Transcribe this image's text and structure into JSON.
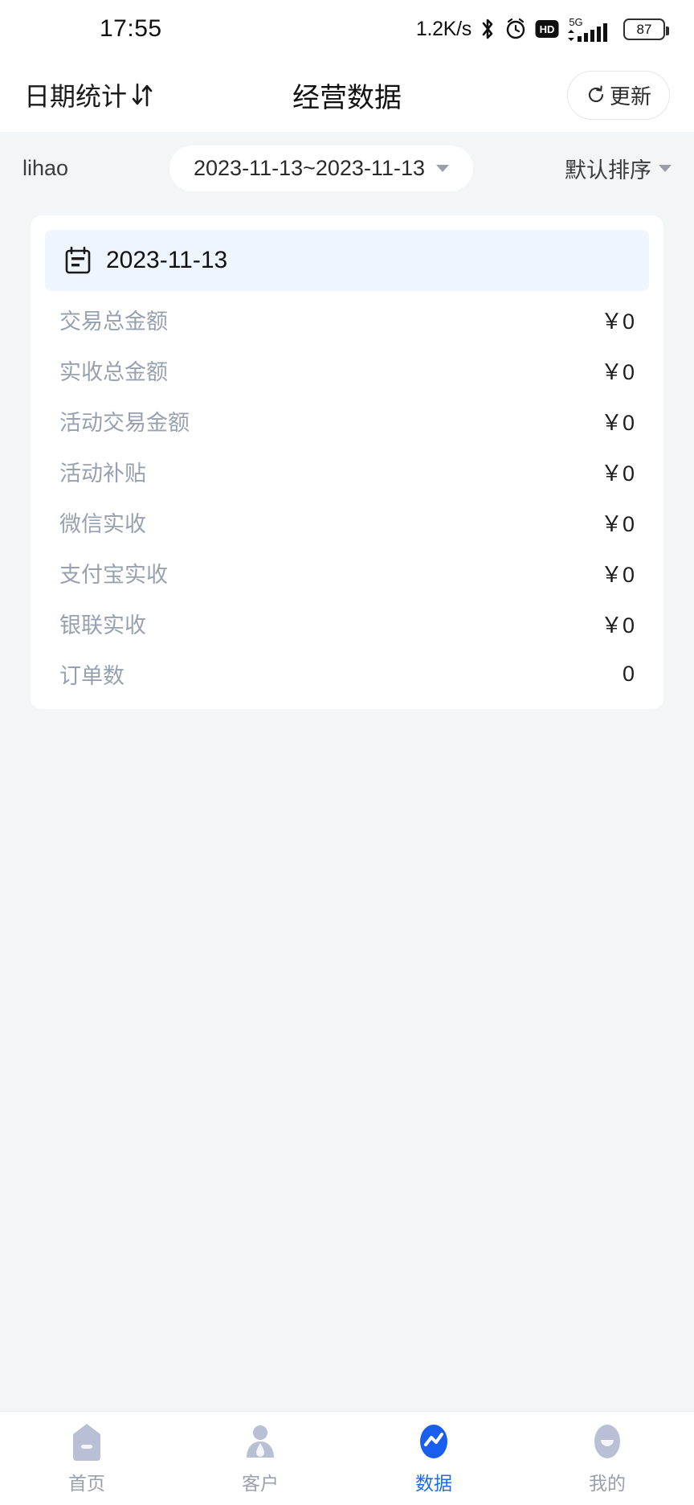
{
  "status_bar": {
    "time": "17:55",
    "network_speed": "1.2K/s",
    "battery_percent": "87",
    "icons": [
      "bluetooth-icon",
      "alarm-icon",
      "hd-icon",
      "signal-5g-icon",
      "battery-icon"
    ]
  },
  "header": {
    "left_label": "日期统计",
    "left_icon": "sort-updown-icon",
    "title": "经营数据",
    "refresh_label": "更新",
    "refresh_icon": "refresh-icon"
  },
  "filter_bar": {
    "user": "lihao",
    "date_range": "2023-11-13~2023-11-13",
    "date_caret": "chevron-down-icon",
    "sort_label": "默认排序",
    "sort_caret": "chevron-down-icon"
  },
  "card": {
    "header_icon": "calendar-icon",
    "date": "2023-11-13",
    "rows": [
      {
        "label": "交易总金额",
        "value": "￥0"
      },
      {
        "label": "实收总金额",
        "value": "￥0"
      },
      {
        "label": "活动交易金额",
        "value": "￥0"
      },
      {
        "label": "活动补贴",
        "value": "￥0"
      },
      {
        "label": "微信实收",
        "value": "￥0"
      },
      {
        "label": "支付宝实收",
        "value": "￥0"
      },
      {
        "label": "银联实收",
        "value": "￥0"
      },
      {
        "label": "订单数",
        "value": "0"
      }
    ]
  },
  "bottom_nav": {
    "active_index": 2,
    "items": [
      {
        "label": "首页",
        "icon": "home-icon"
      },
      {
        "label": "客户",
        "icon": "customer-icon"
      },
      {
        "label": "数据",
        "icon": "chart-icon"
      },
      {
        "label": "我的",
        "icon": "profile-icon"
      }
    ]
  },
  "colors": {
    "accent": "#1a6ef5",
    "page_bg": "#f4f5f7",
    "card_bg": "#ffffff",
    "card_head_bg": "#eef5fd",
    "label_text": "#98a1af",
    "value_text": "#1d1d1d"
  }
}
